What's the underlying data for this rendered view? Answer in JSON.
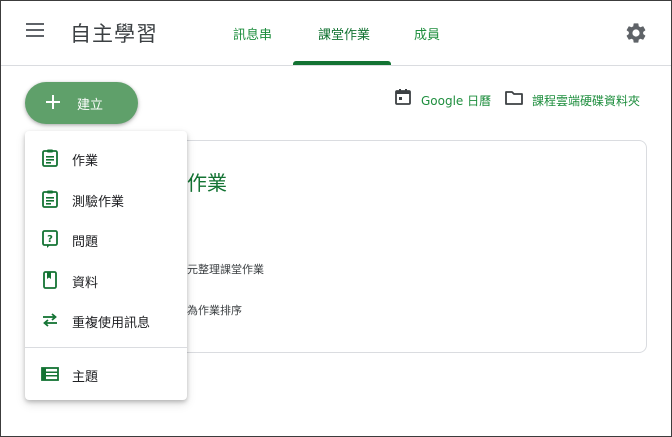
{
  "app": {
    "title": "自主學習"
  },
  "tabs": [
    {
      "label": "訊息串"
    },
    {
      "label": "課堂作業"
    },
    {
      "label": "成員"
    }
  ],
  "create_button": {
    "label": "建立"
  },
  "links": {
    "calendar": "Google 日曆",
    "drive": "課程雲端硬碟資料夾"
  },
  "card": {
    "title": "作業",
    "line1": "元整理課堂作業",
    "line2": "為作業排序"
  },
  "menu": {
    "items": [
      {
        "label": "作業",
        "icon": "assignment-icon"
      },
      {
        "label": "測驗作業",
        "icon": "quiz-assignment-icon"
      },
      {
        "label": "問題",
        "icon": "question-icon"
      },
      {
        "label": "資料",
        "icon": "material-icon"
      },
      {
        "label": "重複使用訊息",
        "icon": "reuse-post-icon"
      },
      {
        "label": "主題",
        "icon": "topic-icon"
      }
    ]
  },
  "colors": {
    "accent": "#137333",
    "link": "#1e8e3e",
    "create_button": "#5fa06a",
    "icon_green": "#137333"
  }
}
